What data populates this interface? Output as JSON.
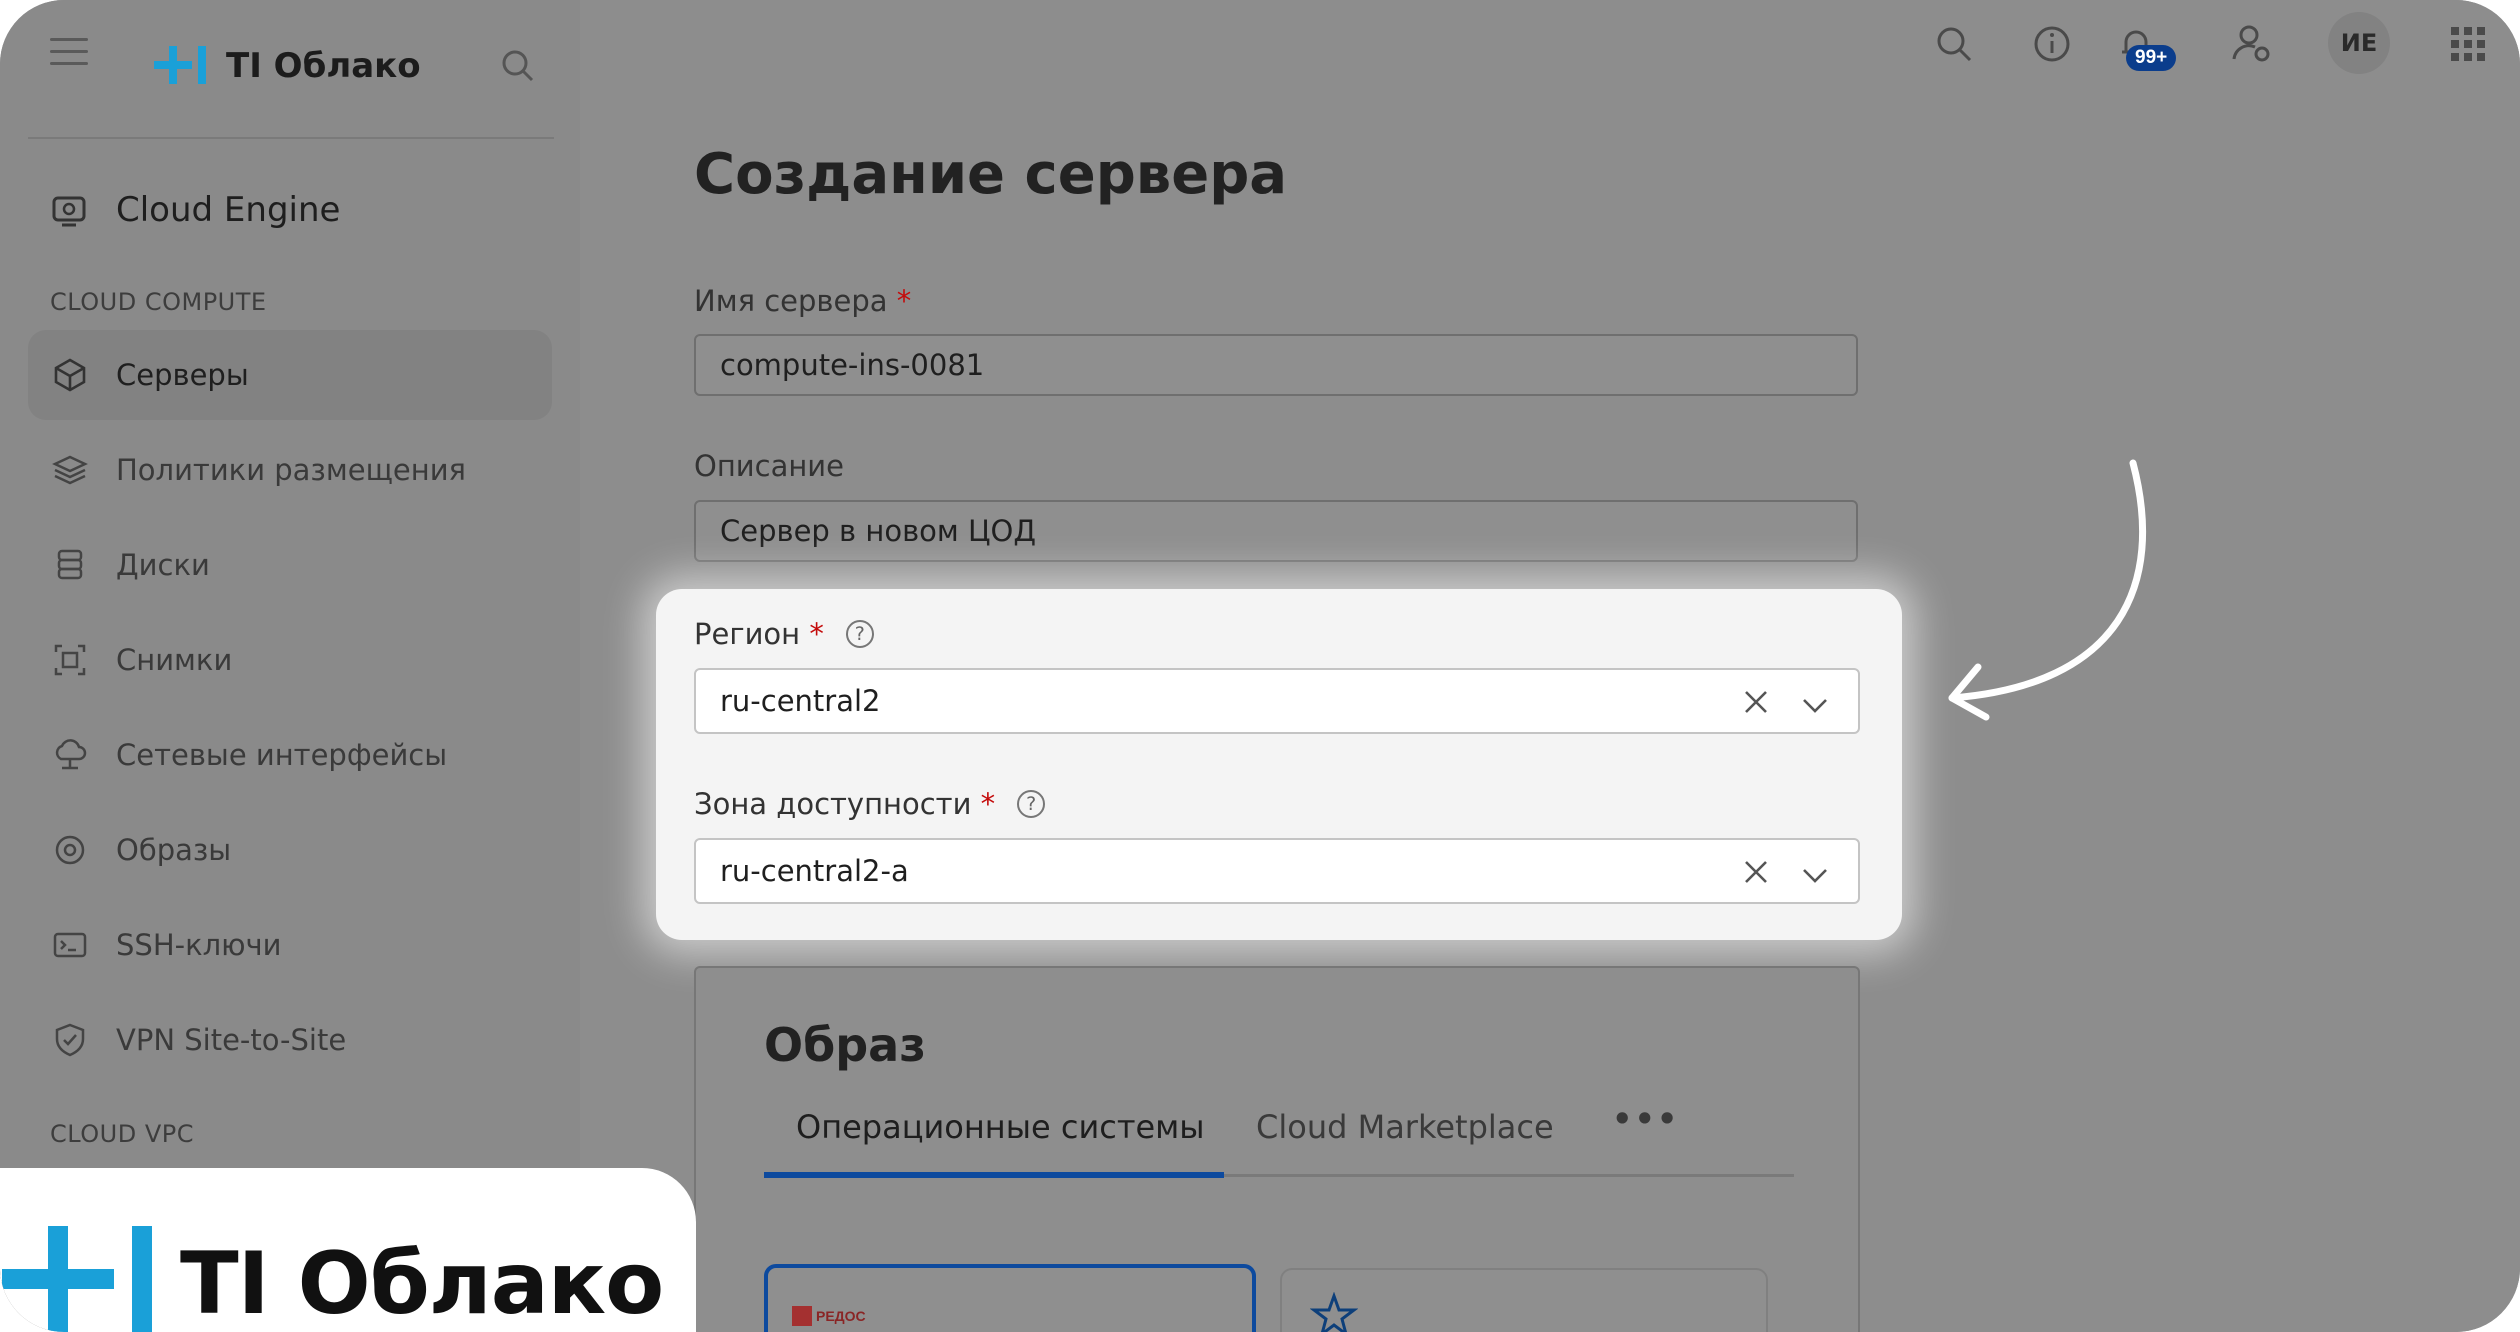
{
  "brand": {
    "name": "TI Облако"
  },
  "colors": {
    "accent": "#0d4a9e",
    "brand_cyan": "#1aa0d8",
    "required": "#c40b0b"
  },
  "sidebar": {
    "menu_icon": "hamburger-icon",
    "search_icon": "search-icon",
    "header": "Cloud Engine",
    "sections": [
      {
        "title": "CLOUD COMPUTE"
      },
      {
        "title": "CLOUD VPC"
      }
    ],
    "items": [
      {
        "label": "Серверы",
        "icon": "cube-icon",
        "active": true
      },
      {
        "label": "Политики размещения",
        "icon": "layers-icon"
      },
      {
        "label": "Диски",
        "icon": "database-icon"
      },
      {
        "label": "Снимки",
        "icon": "snapshot-icon"
      },
      {
        "label": "Сетевые интерфейсы",
        "icon": "cloud-network-icon"
      },
      {
        "label": "Образы",
        "icon": "image-icon"
      },
      {
        "label": "SSH-ключи",
        "icon": "terminal-key-icon"
      },
      {
        "label": "VPN Site-to-Site",
        "icon": "shield-icon"
      }
    ]
  },
  "topbar": {
    "icons": [
      "search-icon",
      "info-icon",
      "bell-icon",
      "user-settings-icon",
      "apps-grid-icon"
    ],
    "notification_badge": "99+",
    "avatar_initials": "ИЕ"
  },
  "form": {
    "title": "Создание сервера",
    "server_name": {
      "label": "Имя сервера",
      "required_mark": "*",
      "value": "compute-ins-0081"
    },
    "description": {
      "label": "Описание",
      "value": "Сервер в новом ЦОД"
    },
    "region": {
      "label": "Регион",
      "required_mark": "*",
      "help": "?",
      "value": "ru-central2"
    },
    "zone": {
      "label": "Зона доступности",
      "required_mark": "*",
      "help": "?",
      "value": "ru-central2-a"
    }
  },
  "image_section": {
    "title": "Образ",
    "tabs": [
      {
        "label": "Операционные системы",
        "active": true
      },
      {
        "label": "Cloud Marketplace",
        "active": false
      }
    ],
    "more": "•••",
    "cards": [
      {
        "logo_text": "РЕДОС",
        "selected": true
      },
      {
        "logo_text": "",
        "selected": false
      }
    ]
  }
}
